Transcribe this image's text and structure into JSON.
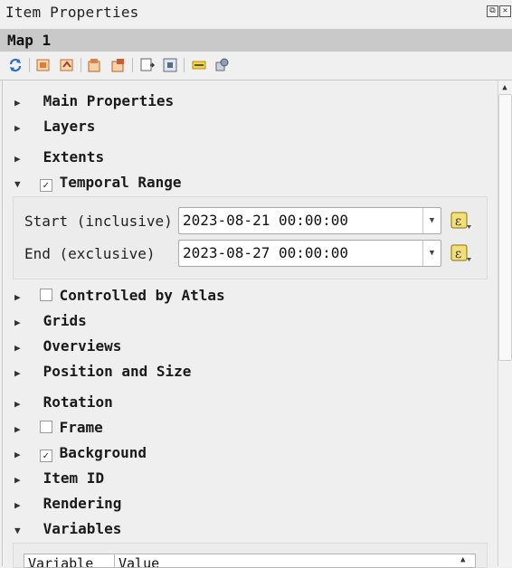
{
  "window": {
    "title": "Item Properties",
    "float_glyph": "⧉",
    "close_glyph": "✕"
  },
  "item_name": "Map 1",
  "toolbar": {
    "icons": [
      "refresh-icon",
      "set-map-extent-icon",
      "view-extent-icon",
      "set-map-scale-icon",
      "view-scale-icon",
      "move-content-icon",
      "zoom-full-icon",
      "label-settings-icon",
      "overview-icon"
    ]
  },
  "sections": {
    "main_properties": "Main Properties",
    "layers": "Layers",
    "extents": "Extents",
    "temporal_range": "Temporal Range",
    "controlled_by_atlas": "Controlled by Atlas",
    "grids": "Grids",
    "overviews": "Overviews",
    "position_and_size": "Position and Size",
    "rotation": "Rotation",
    "frame": "Frame",
    "background": "Background",
    "item_id": "Item ID",
    "rendering": "Rendering",
    "variables": "Variables"
  },
  "checks": {
    "temporal_range": "✓",
    "controlled_by_atlas": "",
    "frame": "",
    "background": "✓"
  },
  "temporal": {
    "start_label": "Start (inclusive)",
    "start_value": "2023-08-21 00:00:00",
    "end_label": "End (exclusive)",
    "end_value": "2023-08-27 00:00:00"
  },
  "variables_table": {
    "headers": [
      "Variable",
      "Value"
    ]
  },
  "arrows": {
    "collapsed": "▶",
    "expanded": "▼",
    "dropdown": "▼",
    "scroll_up": "▲"
  }
}
